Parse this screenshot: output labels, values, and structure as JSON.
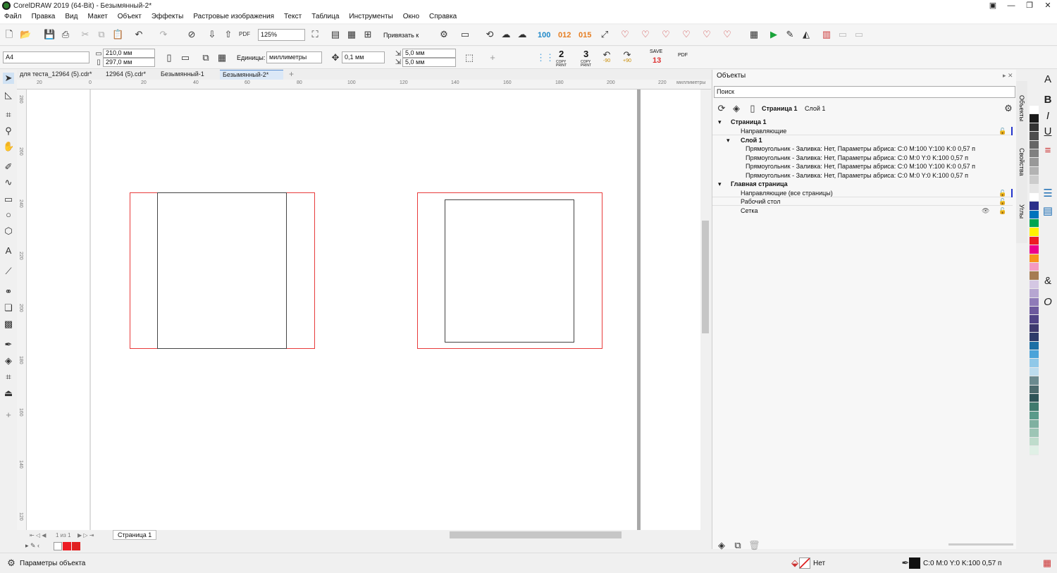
{
  "window": {
    "title": "CorelDRAW 2019 (64-Bit) - Безымянный-2*",
    "minimize": "—",
    "restore": "❐",
    "close": "✕"
  },
  "menu": [
    "Файл",
    "Правка",
    "Вид",
    "Макет",
    "Объект",
    "Эффекты",
    "Растровые изображения",
    "Текст",
    "Таблица",
    "Инструменты",
    "Окно",
    "Справка"
  ],
  "toolbar1": {
    "zoom": "125%",
    "snap_label": "Привязать к",
    "badge_100": "100",
    "badge_012": "012",
    "badge_015": "015",
    "copy2": "2",
    "copy3": "3"
  },
  "propbar": {
    "page_size": "A4",
    "width": "210,0 мм",
    "height": "297,0 мм",
    "units_label": "Единицы:",
    "units_value": "миллиметры",
    "nudge": "0,1 мм",
    "dup_x": "5,0 мм",
    "dup_y": "5,0 мм",
    "copy_label": "COPY",
    "print_label": "PRINT",
    "rot_minus": "-90",
    "rot_plus": "+90",
    "save_label": "SAVE",
    "save_count": "13",
    "pdf_label": "PDF"
  },
  "tabs": [
    "для теста_12964 (5).cdr*",
    "12964 (5).cdr*",
    "Безымянный-1",
    "Безымянный-2*"
  ],
  "ruler": {
    "h_ticks": [
      "20",
      "0",
      "20",
      "40",
      "60",
      "80",
      "100",
      "120",
      "140",
      "160",
      "180",
      "200",
      "220"
    ],
    "units": "миллиметры",
    "v_ticks": [
      "280",
      "260",
      "240",
      "220",
      "200",
      "180",
      "160",
      "140",
      "120"
    ]
  },
  "page_nav": {
    "counter": "1 из 1",
    "page_tab": "Страница 1"
  },
  "docker": {
    "title": "Объекты",
    "search_placeholder": "Поиск",
    "page_label": "Страница 1",
    "layer_label": "Слой 1",
    "tree": {
      "page1": "Страница 1",
      "guides": "Направляющие",
      "layer1": "Слой 1",
      "objects": [
        "Прямоугольник - Заливка: Нет, Параметры абриса: C:0 M:100 Y:100 K:0  0,57 п",
        "Прямоугольник - Заливка: Нет, Параметры абриса: C:0 M:0 Y:0 K:100  0,57 п",
        "Прямоугольник - Заливка: Нет, Параметры абриса: C:0 M:100 Y:100 K:0  0,57 п",
        "Прямоугольник - Заливка: Нет, Параметры абриса: C:0 M:0 Y:0 K:100  0,57 п"
      ],
      "master": "Главная страница",
      "master_guides": "Направляющие (все страницы)",
      "desktop": "Рабочий стол",
      "grid": "Сетка"
    },
    "side_tabs": [
      "Объекты",
      "Свойства",
      "Углы"
    ]
  },
  "palette": [
    "#ffffff",
    "#1a1a1a",
    "#333333",
    "#4d4d4d",
    "#666666",
    "#808080",
    "#999999",
    "#b3b3b3",
    "#cccccc",
    "#e6e6e6",
    "#ffffff",
    "#2b2f8a",
    "#0073bc",
    "#00a651",
    "#fff200",
    "#ed1c24",
    "#ec008c",
    "#f7941d",
    "#f49ac1",
    "#a67c52",
    "#d4c7e3",
    "#b6a6d1",
    "#8f7bb8",
    "#6d5a9e",
    "#514487",
    "#3e3a6e",
    "#2e3c6a",
    "#1d6fa5",
    "#4ba3d9",
    "#90c8e8",
    "#bcdcee",
    "#6b8a8f",
    "#4d6b6e",
    "#2f5458",
    "#3f7a6e",
    "#5a9a8a",
    "#7fb0a0",
    "#9dc5b5",
    "#bfdccc",
    "#e0f0e6"
  ],
  "status": {
    "properties": "Параметры объекта",
    "fill": "Нет",
    "outline": "C:0 M:0 Y:0 K:100  0,57 п"
  },
  "colors": {
    "red_outline": "#e83b3b",
    "page_border": "#444444",
    "tab_active": "#dbe8f7"
  }
}
